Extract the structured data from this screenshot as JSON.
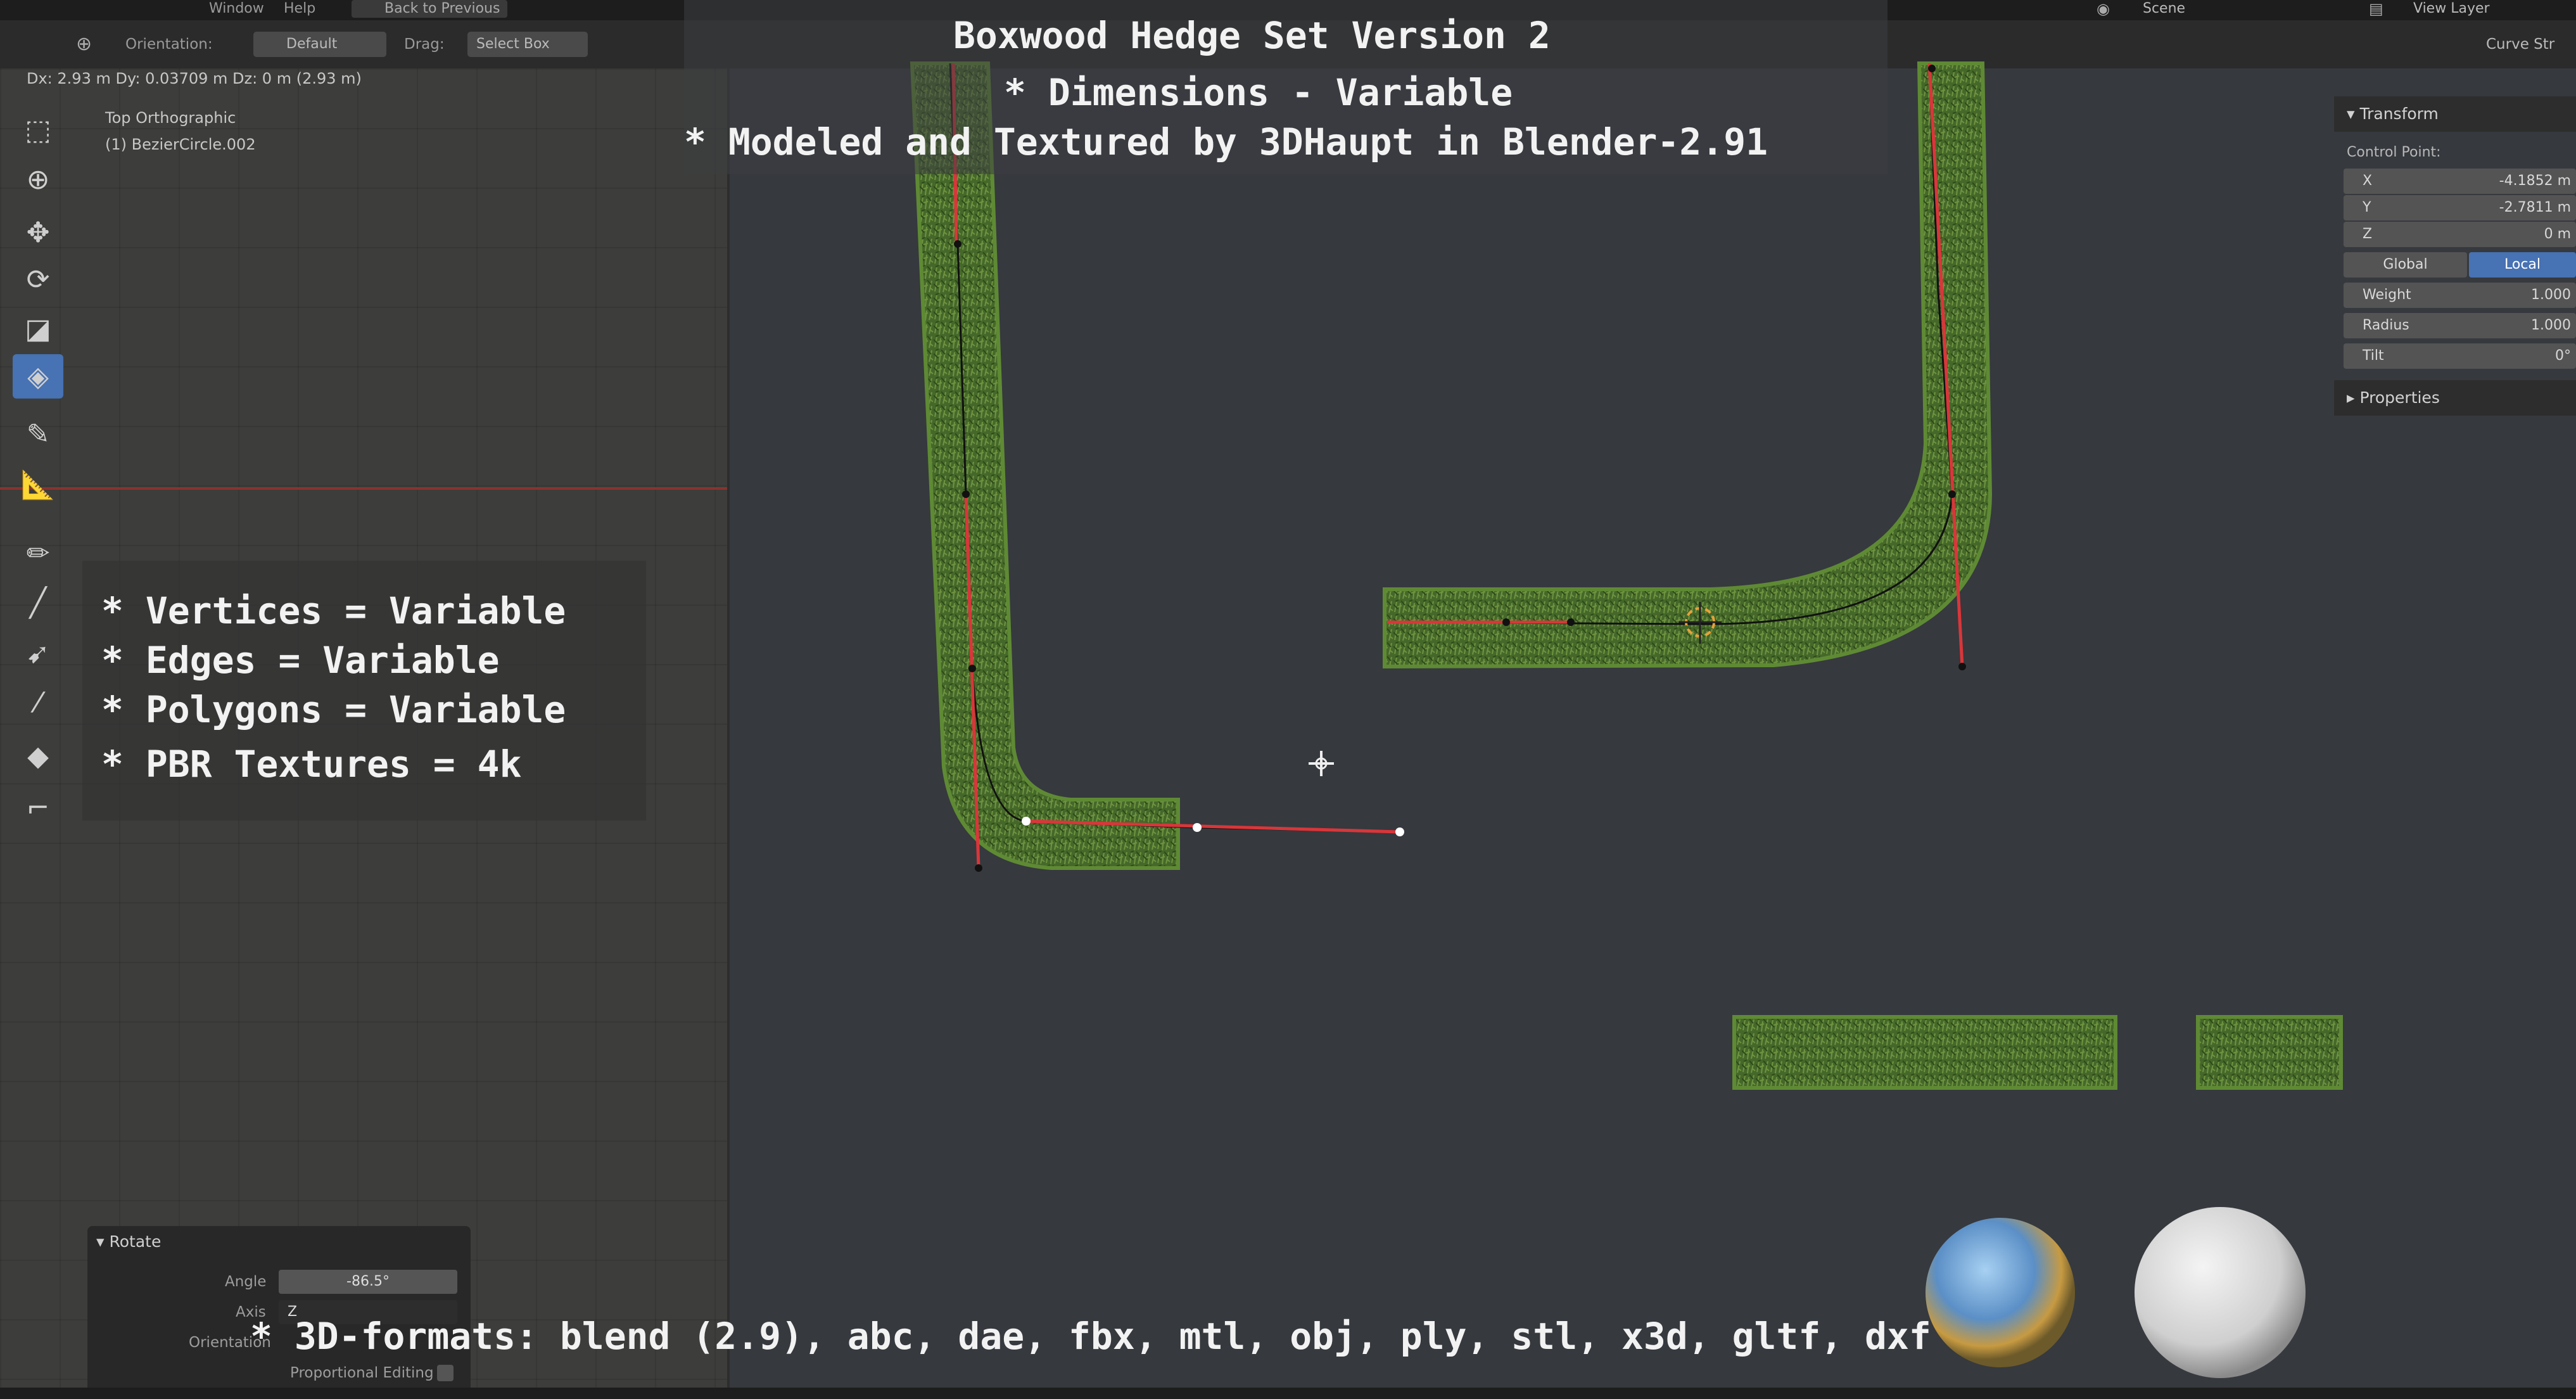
{
  "top_menu": {
    "items": [
      "Window",
      "Help"
    ],
    "back_button": "Back to Previous",
    "scene": "Scene",
    "view_layer": "View Layer",
    "corner": "Curve Str"
  },
  "tool_settings": {
    "orientation_label": "Orientation:",
    "orientation_value": "Default",
    "drag_label": "Drag:",
    "drag_value": "Select Box"
  },
  "viewport": {
    "status": "Dx: 2.93 m   Dy: 0.03709 m   Dz: 0 m (2.93 m)",
    "view_name": "Top Orthographic",
    "object_name": "(1) BezierCircle.002"
  },
  "overlay": {
    "title": "Boxwood Hedge Set Version 2",
    "line1": "* Dimensions - Variable",
    "line2": "* Modeled and Textured by 3DHaupt in Blender-2.91",
    "stats": [
      "* Vertices = Variable",
      "* Edges = Variable",
      "* Polygons = Variable",
      "* PBR Textures = 4k"
    ],
    "formats": "* 3D-formats: blend (2.9), abc, dae, fbx, mtl, obj, ply, stl, x3d, gltf, dxf"
  },
  "properties": {
    "transform_header": "Transform",
    "control_point_label": "Control Point:",
    "x_label": "X",
    "x_value": "-4.1852 m",
    "y_label": "Y",
    "y_value": "-2.7811 m",
    "z_label": "Z",
    "z_value": "0 m",
    "global_label": "Global",
    "local_label": "Local",
    "weight_label": "Weight",
    "weight_value": "1.000",
    "radius_label": "Radius",
    "radius_value": "1.000",
    "tilt_label": "Tilt",
    "tilt_value": "0°",
    "properties_header": "Properties"
  },
  "rotate_panel": {
    "header": "Rotate",
    "angle_label": "Angle",
    "angle_value": "-86.5°",
    "axis_label": "Axis",
    "axis_value": "Z",
    "orientation_label": "Orientation",
    "proportional_label": "Proportional Editing"
  },
  "colors": {
    "accent": "#4772b3",
    "curve_red": "#d9363a"
  }
}
